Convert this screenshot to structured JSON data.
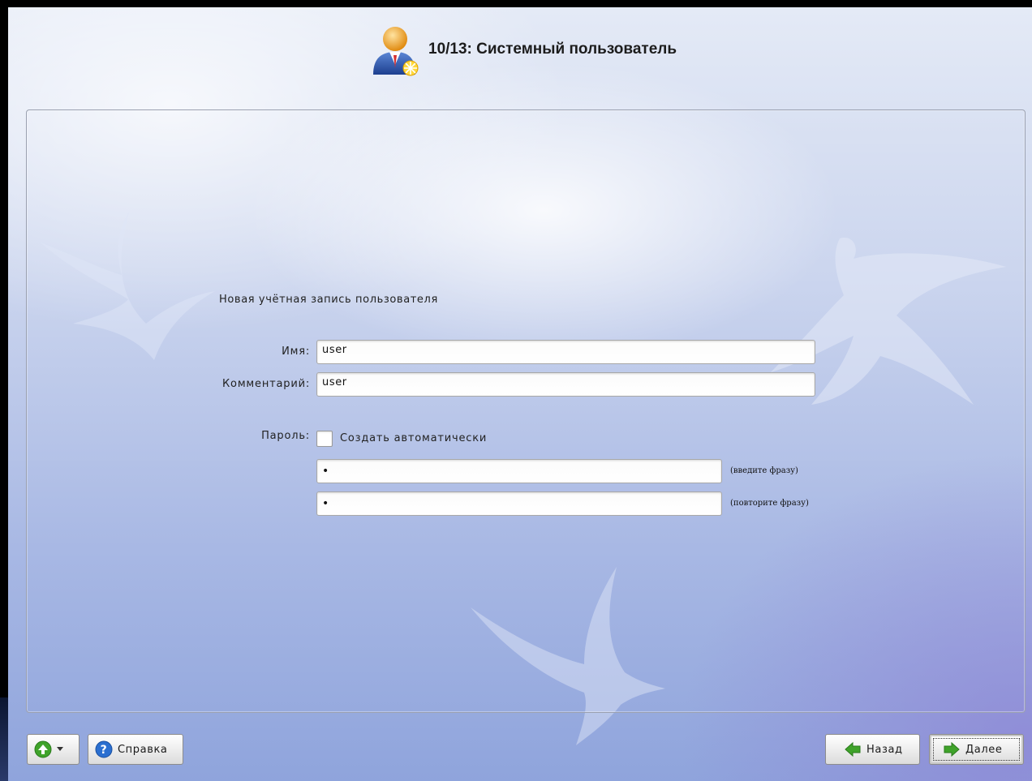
{
  "header": {
    "title": "10/13: Системный пользователь",
    "icon": "user-add-icon"
  },
  "form": {
    "section_title": "Новая учётная запись пользователя",
    "name_label": "Имя:",
    "name_value": "user",
    "comment_label": "Комментарий:",
    "comment_value": "user",
    "password_label": "Пароль:",
    "auto_generate_label": "Создать автоматически",
    "auto_generate_checked": false,
    "password_value": "•",
    "password_hint": "(введите фразу)",
    "password_repeat_value": "•",
    "password_repeat_hint": "(повторите фразу)"
  },
  "footer": {
    "menu_icon": "up-arrow-dropdown-icon",
    "help_label": "Справка",
    "help_icon": "help-icon",
    "back_label": "Назад",
    "back_icon": "arrow-left-icon",
    "next_label": "Далее",
    "next_icon": "arrow-right-icon"
  },
  "colors": {
    "arrow_green": "#3fa32a",
    "help_blue": "#2a6fd0"
  }
}
